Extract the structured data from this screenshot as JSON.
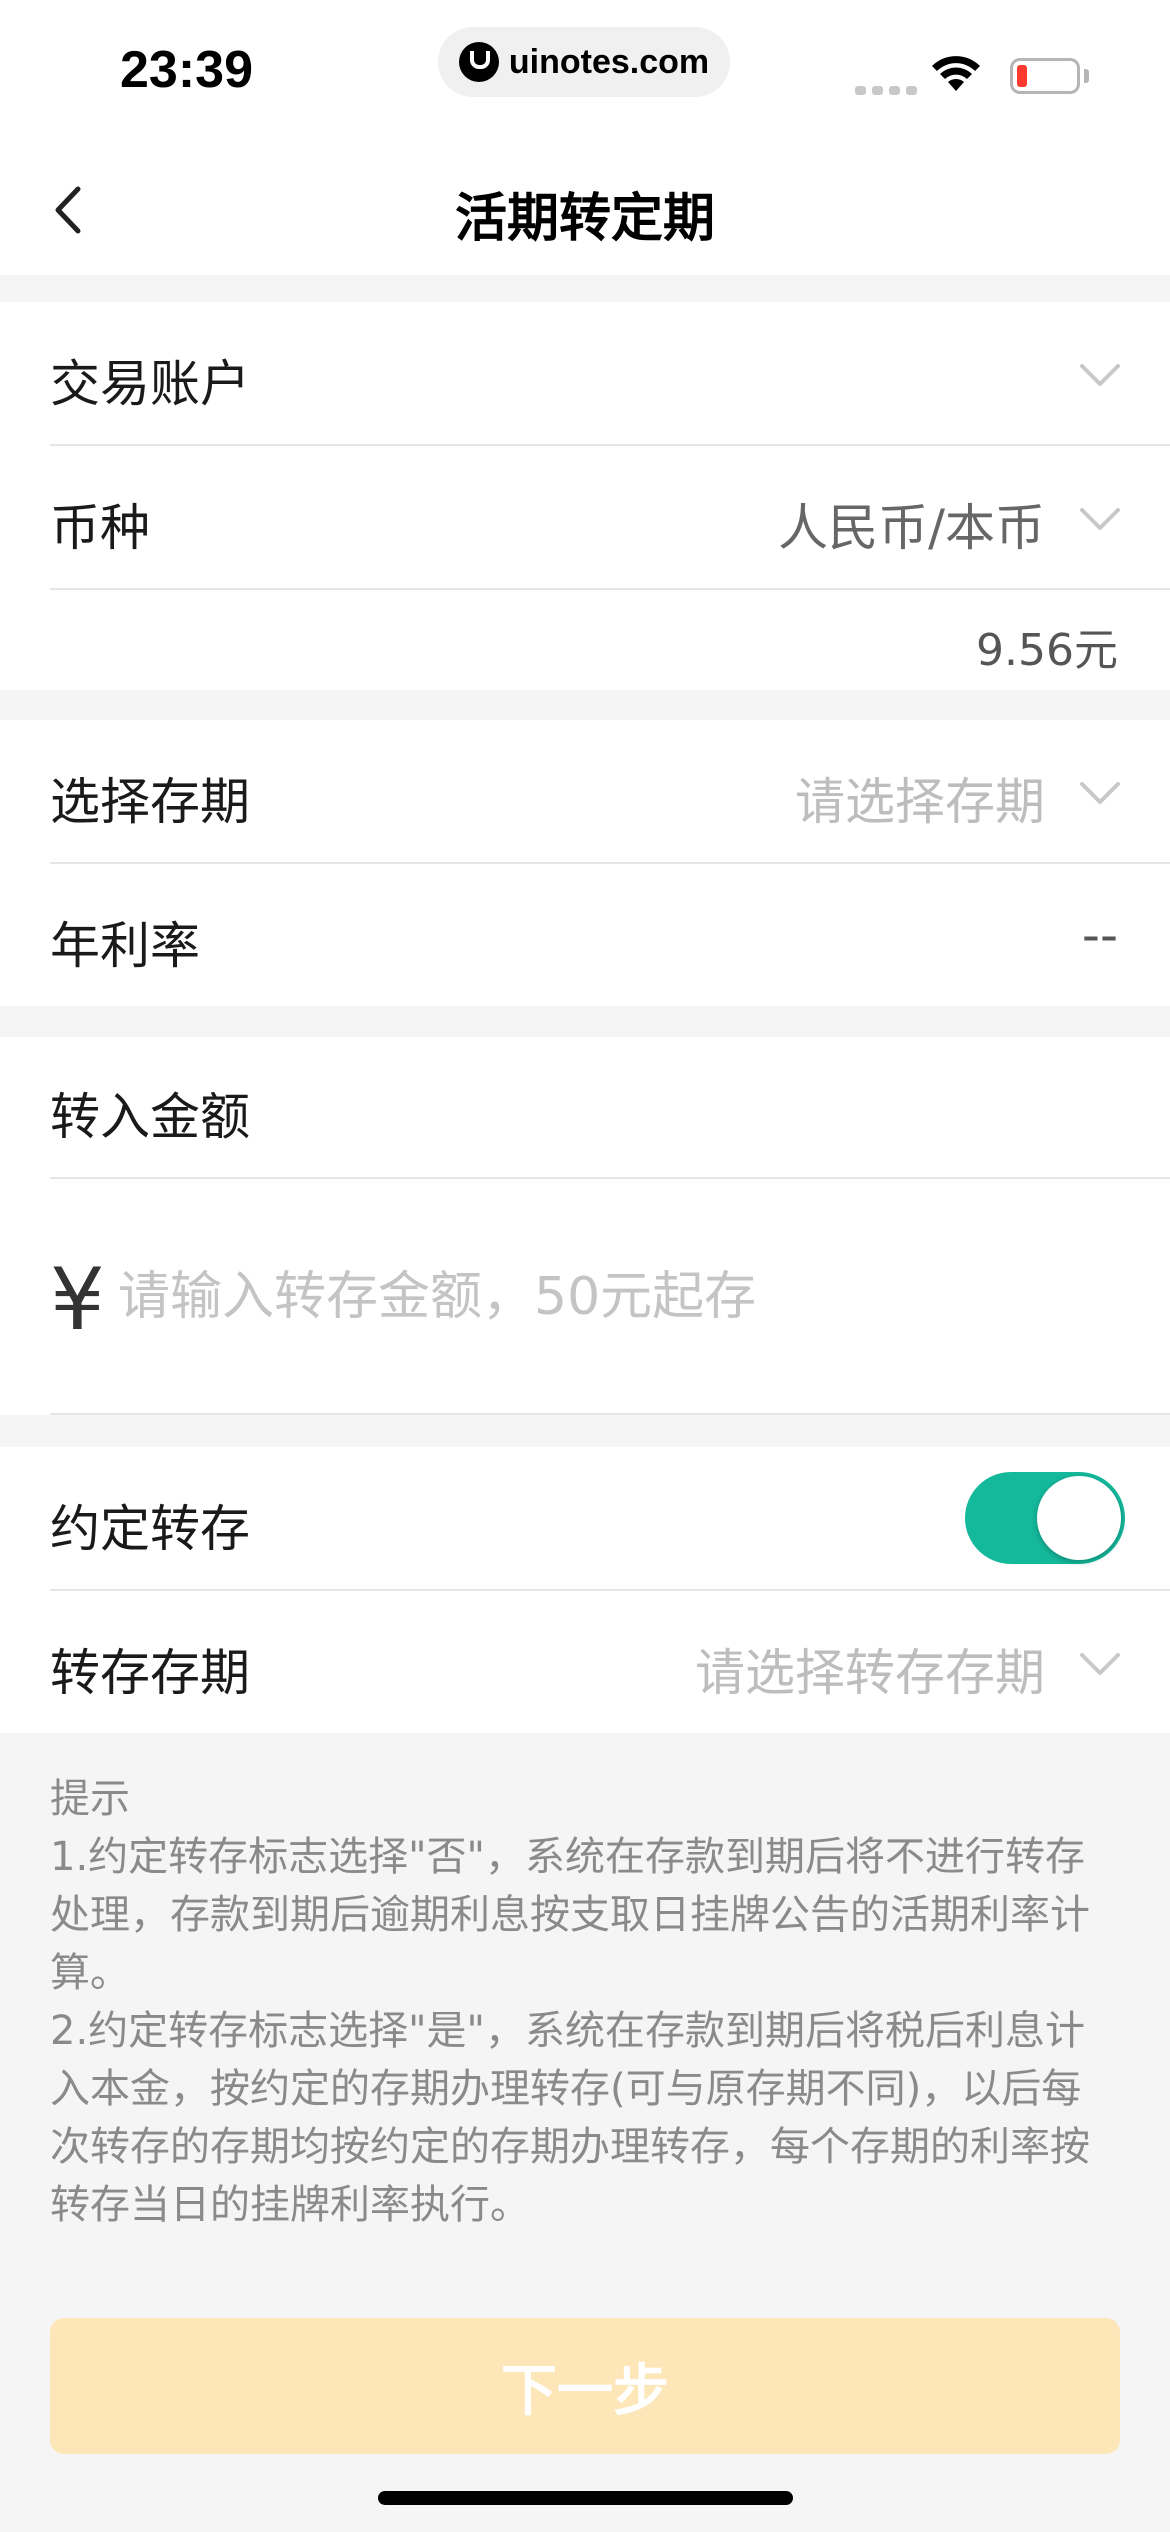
{
  "status_bar": {
    "time": "23:39",
    "url": "uinotes.com",
    "battery_color": "#ff3b30"
  },
  "nav": {
    "title": "活期转定期",
    "back_icon": "chevron-left-icon"
  },
  "account_section": {
    "account_label": "交易账户",
    "account_value": "",
    "currency_label": "币种",
    "currency_value": "人民币/本币",
    "balance": "9.56元"
  },
  "term_section": {
    "term_label": "选择存期",
    "term_placeholder": "请选择存期",
    "rate_label": "年利率",
    "rate_value": "--"
  },
  "amount_section": {
    "label": "转入金额",
    "currency_symbol": "¥",
    "placeholder": "请输入转存金额，50元起存",
    "value": ""
  },
  "renew_section": {
    "auto_renew_label": "约定转存",
    "auto_renew_on": true,
    "renew_term_label": "转存存期",
    "renew_term_placeholder": "请选择转存存期"
  },
  "tips": {
    "title": "提示",
    "item1": "1.约定转存标志选择\"否\"，系统在存款到期后将不进行转存处理，存款到期后逾期利息按支取日挂牌公告的活期利率计算。",
    "item2": "2.约定转存标志选择\"是\"，系统在存款到期后将税后利息计入本金，按约定的存期办理转存(可与原存期不同)，以后每次转存的存期均按约定的存期办理转存，每个存期的利率按转存当日的挂牌利率执行。"
  },
  "actions": {
    "next_label": "下一步"
  },
  "colors": {
    "accent_toggle": "#14b89b",
    "button_disabled": "#fde7b8",
    "background": "#f5f5f5"
  }
}
